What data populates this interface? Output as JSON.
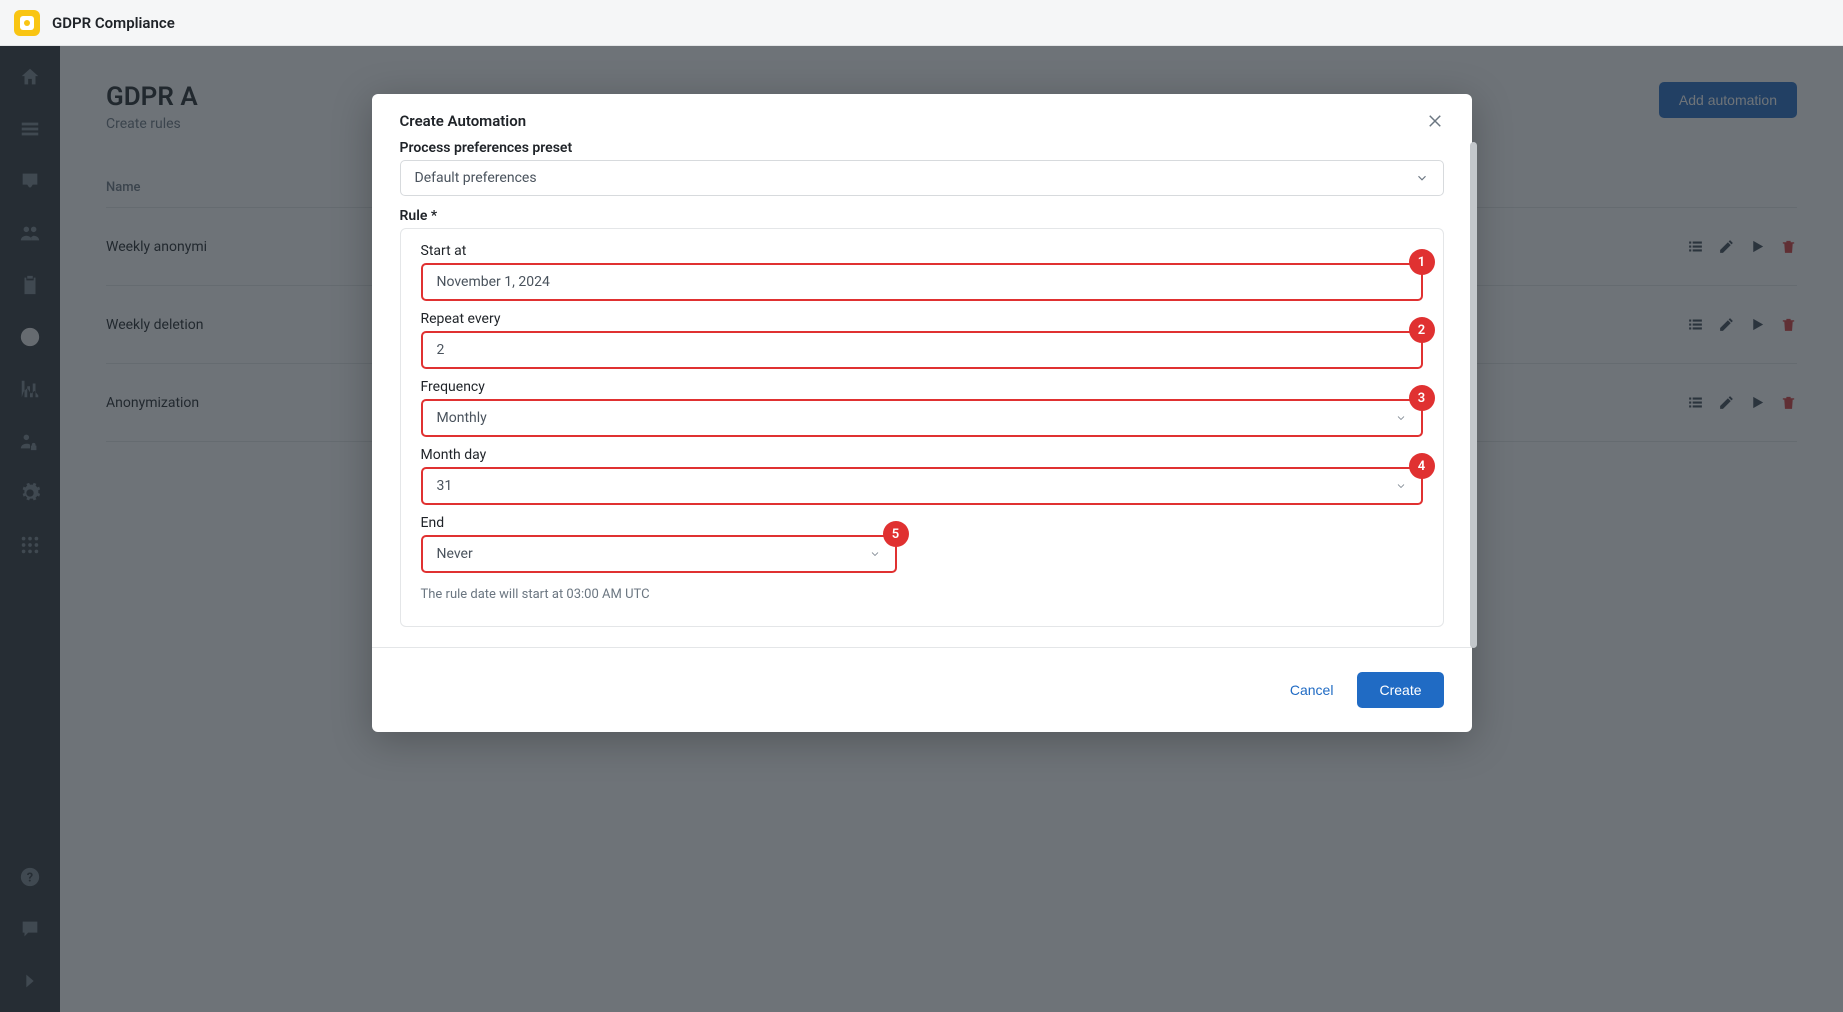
{
  "app": {
    "title": "GDPR Compliance"
  },
  "page": {
    "title": "GDPR A",
    "subtitle": "Create rules",
    "add_button": "Add automation",
    "columns": {
      "name": "Name"
    },
    "rows": [
      {
        "name": "Weekly anonymi"
      },
      {
        "name": "Weekly deletion"
      },
      {
        "name": "Anonymization"
      }
    ]
  },
  "modal": {
    "title": "Create Automation",
    "preset_label": "Process preferences preset",
    "preset_value": "Default preferences",
    "rule_label": "Rule *",
    "fields": {
      "start_label": "Start at",
      "start_value": "November 1, 2024",
      "repeat_label": "Repeat every",
      "repeat_value": "2",
      "frequency_label": "Frequency",
      "frequency_value": "Monthly",
      "monthday_label": "Month day",
      "monthday_value": "31",
      "end_label": "End",
      "end_value": "Never"
    },
    "badges": {
      "b1": "1",
      "b2": "2",
      "b3": "3",
      "b4": "4",
      "b5": "5"
    },
    "hint": "The rule date will start at 03:00 AM UTC",
    "cancel": "Cancel",
    "create": "Create"
  }
}
